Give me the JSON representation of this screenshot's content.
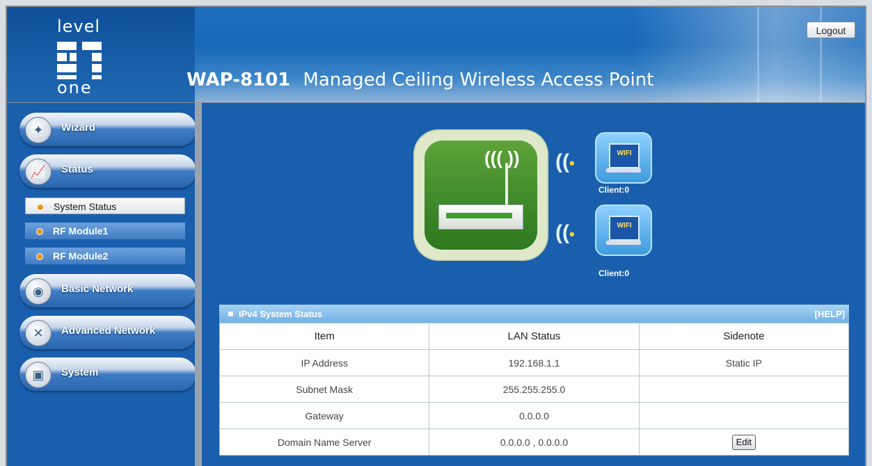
{
  "header": {
    "logo_top": "level",
    "logo_bottom": "one",
    "model": "WAP-8101",
    "subtitle": "Managed Ceiling Wireless Access Point",
    "logout_label": "Logout"
  },
  "sidebar": {
    "wizard": "Wizard",
    "status": "Status",
    "status_sub": [
      "System Status",
      "RF Module1",
      "RF Module2"
    ],
    "basic_network": "Basic Network",
    "advanced_network": "Advanced Network",
    "system": "System"
  },
  "diagram": {
    "client1": "Client:0",
    "client2": "Client:0",
    "wifi_badge": "WIFI"
  },
  "status_panel": {
    "title": "IPv4 System Status",
    "help": "[HELP]",
    "columns": [
      "Item",
      "LAN Status",
      "Sidenote"
    ],
    "rows": [
      [
        "IP Address",
        "192.168.1.1",
        "Static IP"
      ],
      [
        "Subnet Mask",
        "255.255.255.0",
        ""
      ],
      [
        "Gateway",
        "0.0.0.0",
        ""
      ],
      [
        "Domain Name Server",
        "0.0.0.0 , 0.0.0.0",
        ""
      ]
    ],
    "edit_label": "Edit"
  },
  "colors": {
    "header_blue": "#1768b8",
    "panel_blue": "#1a5fae",
    "panel_header": "#6fb1e6",
    "device_green": "#3f8a2a"
  }
}
